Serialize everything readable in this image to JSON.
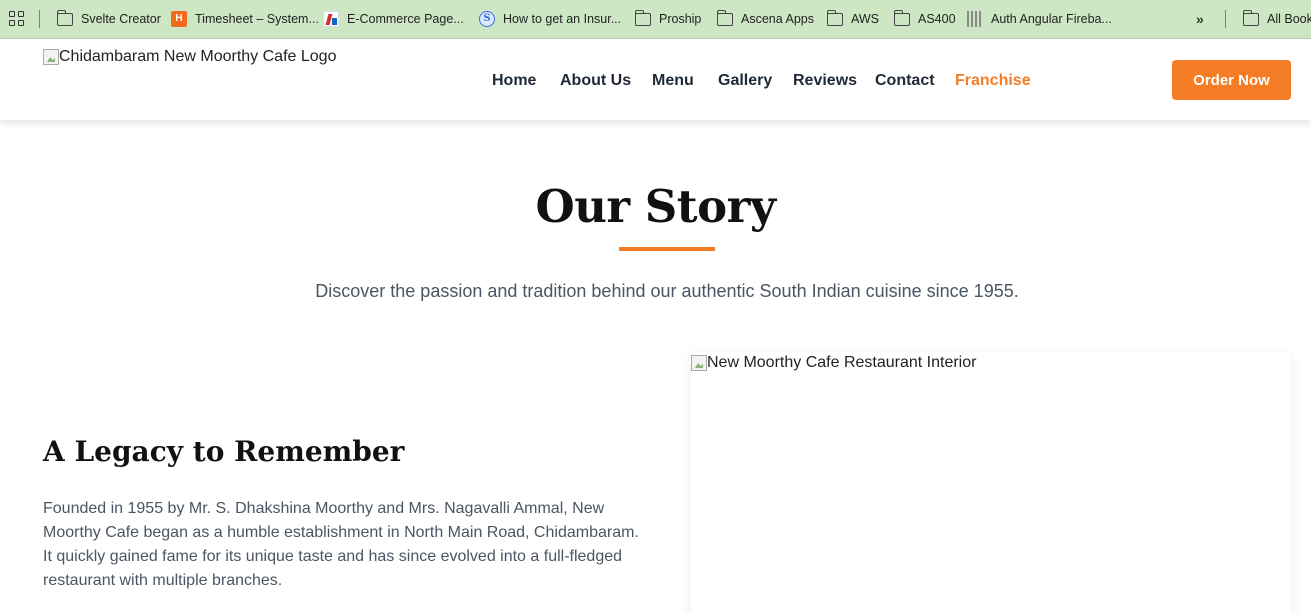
{
  "bookmarks_bar": {
    "items": [
      {
        "label": "Svelte Creator",
        "icon": "folder-icon"
      },
      {
        "label": "Timesheet – System...",
        "icon": "timesheet-icon"
      },
      {
        "label": "E-Commerce Page...",
        "icon": "ecommerce-icon"
      },
      {
        "label": "How to get an Insur...",
        "icon": "s-site-icon"
      },
      {
        "label": "Proship",
        "icon": "folder-icon"
      },
      {
        "label": "Ascena Apps",
        "icon": "folder-icon"
      },
      {
        "label": "AWS",
        "icon": "folder-icon"
      },
      {
        "label": "AS400",
        "icon": "folder-icon"
      },
      {
        "label": "Auth Angular Fireba...",
        "icon": "auth-site-icon"
      }
    ],
    "overflow_label": "»",
    "all_bookmarks_label": "All Bookmarks"
  },
  "header": {
    "logo_alt": "Chidambaram New Moorthy Cafe Logo",
    "nav": [
      {
        "label": "Home"
      },
      {
        "label": "About Us"
      },
      {
        "label": "Menu"
      },
      {
        "label": "Gallery"
      },
      {
        "label": "Reviews"
      },
      {
        "label": "Contact"
      },
      {
        "label": "Franchise",
        "active": true
      }
    ],
    "order_button": "Order Now"
  },
  "story": {
    "title": "Our Story",
    "subtitle": "Discover the passion and tradition behind our authentic South Indian cuisine since 1955.",
    "legacy_title": "A Legacy to Remember",
    "legacy_text": "Founded in 1955 by Mr. S. Dhakshina Moorthy and Mrs. Nagavalli Ammal, New Moorthy Cafe began as a humble establishment in North Main Road, Chidambaram. It quickly gained fame for its unique taste and has since evolved into a full-fledged restaurant with multiple branches.",
    "image_alt": "New Moorthy Cafe Restaurant Interior"
  },
  "colors": {
    "accent": "#f47c24",
    "bookmarks_bg": "#cde6c4"
  }
}
